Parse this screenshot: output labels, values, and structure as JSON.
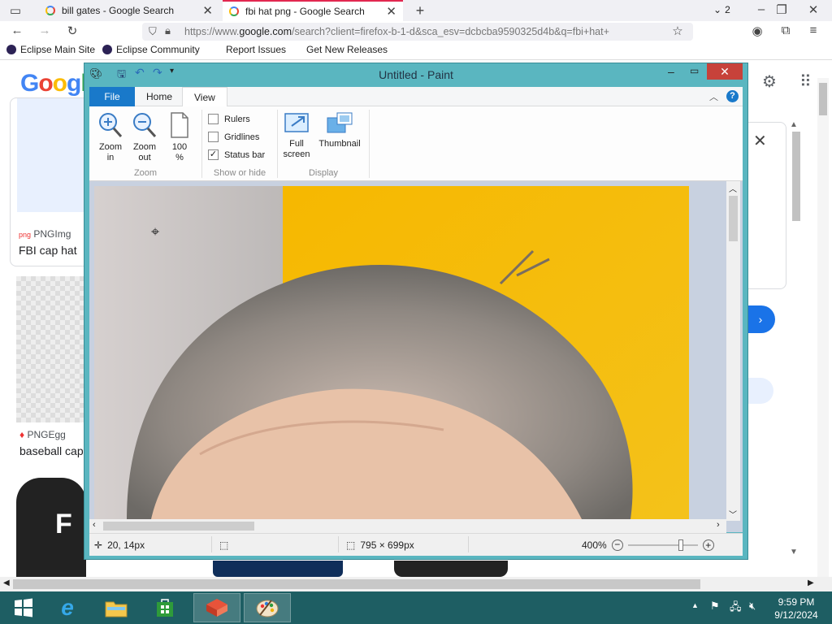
{
  "browser": {
    "tabs": [
      {
        "label": "bill gates - Google Search"
      },
      {
        "label": "fbi hat png - Google Search"
      }
    ],
    "tab_count": "2",
    "url_prefix": "https://www.",
    "url_domain": "google.com",
    "url_rest": "/search?client=firefox-b-1-d&sca_esv=dcbcba9590325d4b&q=fbi+hat+",
    "bookmarks": [
      "Eclipse Main Site",
      "Eclipse Community",
      "Report Issues",
      "Get New Releases"
    ]
  },
  "google": {
    "logo": "Googl",
    "results": [
      {
        "source": "PNGImg",
        "title": "FBI cap hat"
      },
      {
        "source": "PNGEgg",
        "title": "baseball cap"
      }
    ]
  },
  "paint": {
    "title": "Untitled - Paint",
    "tabs": {
      "file": "File",
      "home": "Home",
      "view": "View"
    },
    "zoom_group": {
      "label": "Zoom",
      "zoom_in": [
        "Zoom",
        "in"
      ],
      "zoom_out": [
        "Zoom",
        "out"
      ],
      "hundred": [
        "100",
        "%"
      ]
    },
    "show_group": {
      "label": "Show or hide",
      "rulers": "Rulers",
      "gridlines": "Gridlines",
      "status_bar": "Status bar"
    },
    "display_group": {
      "label": "Display",
      "full_screen": [
        "Full",
        "screen"
      ],
      "thumbnail": "Thumbnail"
    },
    "status": {
      "cursor": "20, 14px",
      "size": "795 × 699px",
      "zoom": "400%"
    },
    "zoom_slider_fraction": 0.78
  },
  "taskbar": {
    "time": "9:59 PM",
    "date": "9/12/2024"
  },
  "colors": {
    "paint_frame": "#5ab6c0",
    "taskbar": "#1e5e63",
    "file_tab": "#1979ca",
    "firefox_accent": "#e22850"
  }
}
